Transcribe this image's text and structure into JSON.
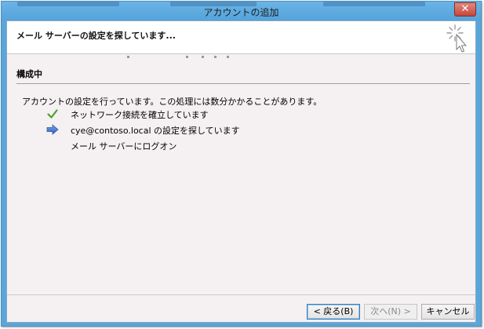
{
  "window": {
    "title": "アカウントの追加",
    "close_glyph": "✕"
  },
  "header": {
    "title": "メール サーバーの設定を探しています..."
  },
  "section": {
    "title": "構成中",
    "description": "アカウントの設定を行っています。この処理には数分かかることがあります。"
  },
  "steps": [
    {
      "label": "ネットワーク接続を確立しています",
      "icon": "checkmark-icon",
      "status": "done",
      "color": "#4aa02c"
    },
    {
      "label": "cye@contoso.local の設定を探しています",
      "icon": "arrow-right-icon",
      "status": "in-progress",
      "color": "#3d6fc7"
    },
    {
      "label": "メール サーバーにログオン",
      "icon": "",
      "status": "pending"
    }
  ],
  "buttons": {
    "back": "< 戻る(B)",
    "next": "次へ(N) >",
    "cancel": "キャンセル"
  }
}
